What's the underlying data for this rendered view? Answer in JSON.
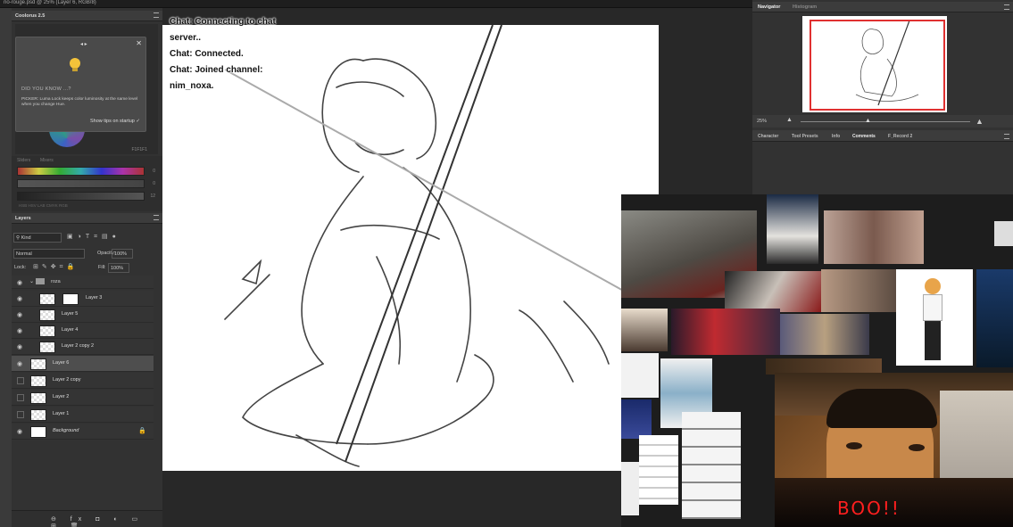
{
  "window": {
    "title": "no-rouge.psd @ 25% (Layer 6, RGB/8)"
  },
  "colorPanel": {
    "title": "Coolorus 2.5"
  },
  "tip": {
    "heading": "DID YOU KNOW ...?",
    "body": "PICKER: Luma Lock keeps color luminosity at the same level when you change Hue.",
    "show_label": "Show tips on startup",
    "nav": "◂  ▸",
    "close": "✕",
    "check": "✓"
  },
  "sliders": {
    "tab1": "Sliders",
    "tab2": "Mixers",
    "values": [
      "0",
      "0",
      "12"
    ],
    "modes": "HSB  HSV  LAB  CMYK  RGB",
    "hex": "F1F1F1"
  },
  "layersPanel": {
    "title": "Layers",
    "filter": "Kind",
    "blend": "Normal",
    "opacity_label": "Opacity:",
    "opacity_value": "100%",
    "lock_label": "Lock:",
    "fill_label": "Fill:",
    "fill_value": "100%",
    "group": "roza",
    "layers": [
      {
        "name": "Layer 3",
        "visible": true
      },
      {
        "name": "Layer 5",
        "visible": true
      },
      {
        "name": "Layer 4",
        "visible": true
      },
      {
        "name": "Layer 2 copy 2",
        "visible": true
      },
      {
        "name": "Layer 6",
        "visible": true,
        "selected": true
      },
      {
        "name": "Layer 2 copy",
        "visible": false
      },
      {
        "name": "Layer 2",
        "visible": false
      },
      {
        "name": "Layer 1",
        "visible": false
      },
      {
        "name": "Background",
        "visible": true
      }
    ],
    "footer_icons": "⊖ fx ◘ ◐ ▭ ⊞ 🗑"
  },
  "chat": {
    "lines": [
      "Chat: Connecting to chat server..",
      "Chat: Connected.",
      "Chat: Joined channel:",
      "nim_noxa."
    ]
  },
  "navigator": {
    "tab1": "Navigator",
    "tab2": "Histogram",
    "zoom": "25%"
  },
  "rightTabs": [
    "Character",
    "Tool Presets",
    "Info",
    "Comments",
    "F_Record 2"
  ],
  "overlay": {
    "caption": "BOO!!"
  },
  "colors": {
    "accent": "#e03030",
    "panel": "#323232",
    "selected": "#4e4e4e"
  }
}
